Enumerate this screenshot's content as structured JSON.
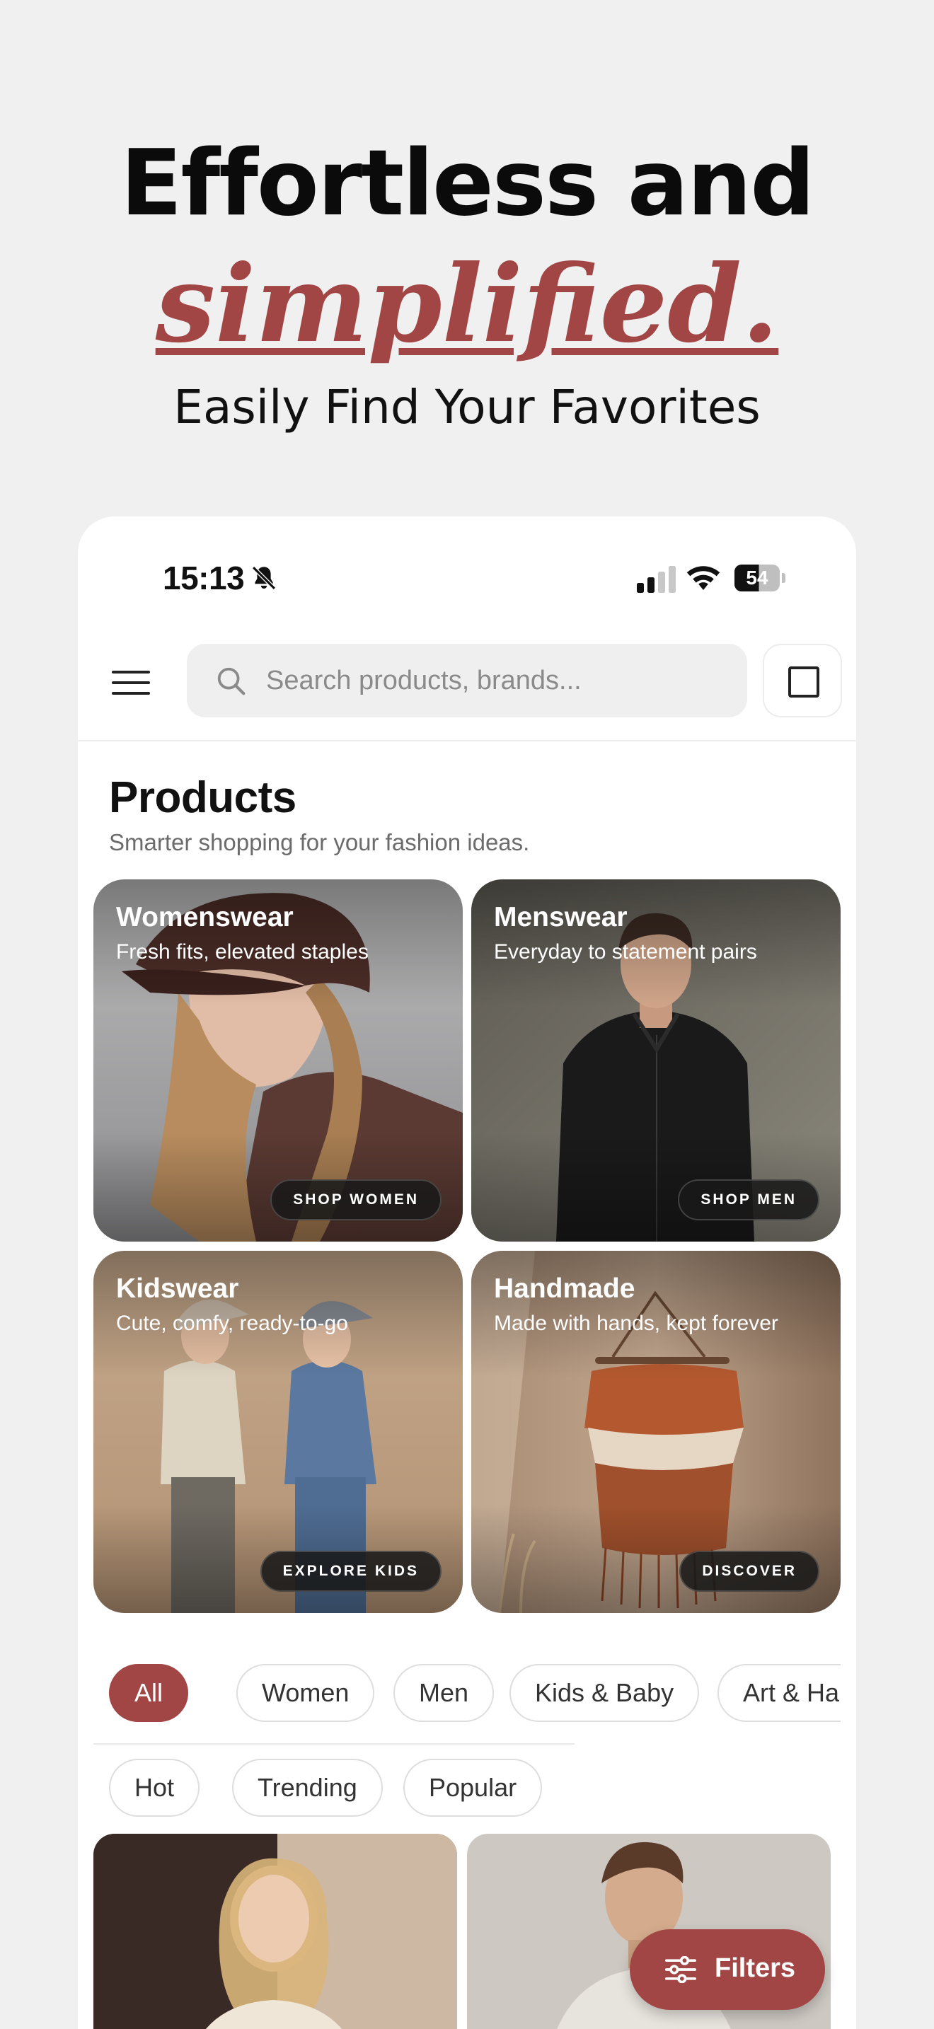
{
  "hero": {
    "line1": "Effortless and",
    "line2": "simplified.",
    "line3": "Easily Find Your Favorites"
  },
  "status_bar": {
    "time": "15:13",
    "battery": "54",
    "icons": [
      "bell-slash-icon",
      "cellular-signal-icon",
      "wifi-icon",
      "battery-icon"
    ]
  },
  "top_bar": {
    "menu_icon": "hamburger-menu-icon",
    "search_placeholder": "Search products, brands...",
    "square_icon": "square-icon"
  },
  "section": {
    "title": "Products",
    "subtitle": "Smarter shopping for your fashion ideas."
  },
  "categories": [
    {
      "title": "Womenswear",
      "subtitle": "Fresh fits, elevated staples",
      "button": "SHOP WOMEN"
    },
    {
      "title": "Menswear",
      "subtitle": "Everyday to statement pairs",
      "button": "SHOP MEN"
    },
    {
      "title": "Kidswear",
      "subtitle": "Cute, comfy, ready-to-go",
      "button": "EXPLORE KIDS"
    },
    {
      "title": "Handmade",
      "subtitle": "Made with hands, kept forever",
      "button": "DISCOVER"
    }
  ],
  "filter_chips": {
    "row1": [
      "All",
      "Women",
      "Men",
      "Kids & Baby",
      "Art & Han"
    ],
    "row2": [
      "Hot",
      "Trending",
      "Popular"
    ],
    "active": "All"
  },
  "filters_button": {
    "label": "Filters",
    "icon": "sliders-icon"
  },
  "colors": {
    "accent": "#a14645",
    "background": "#f0f0f0",
    "card": "#ffffff"
  }
}
